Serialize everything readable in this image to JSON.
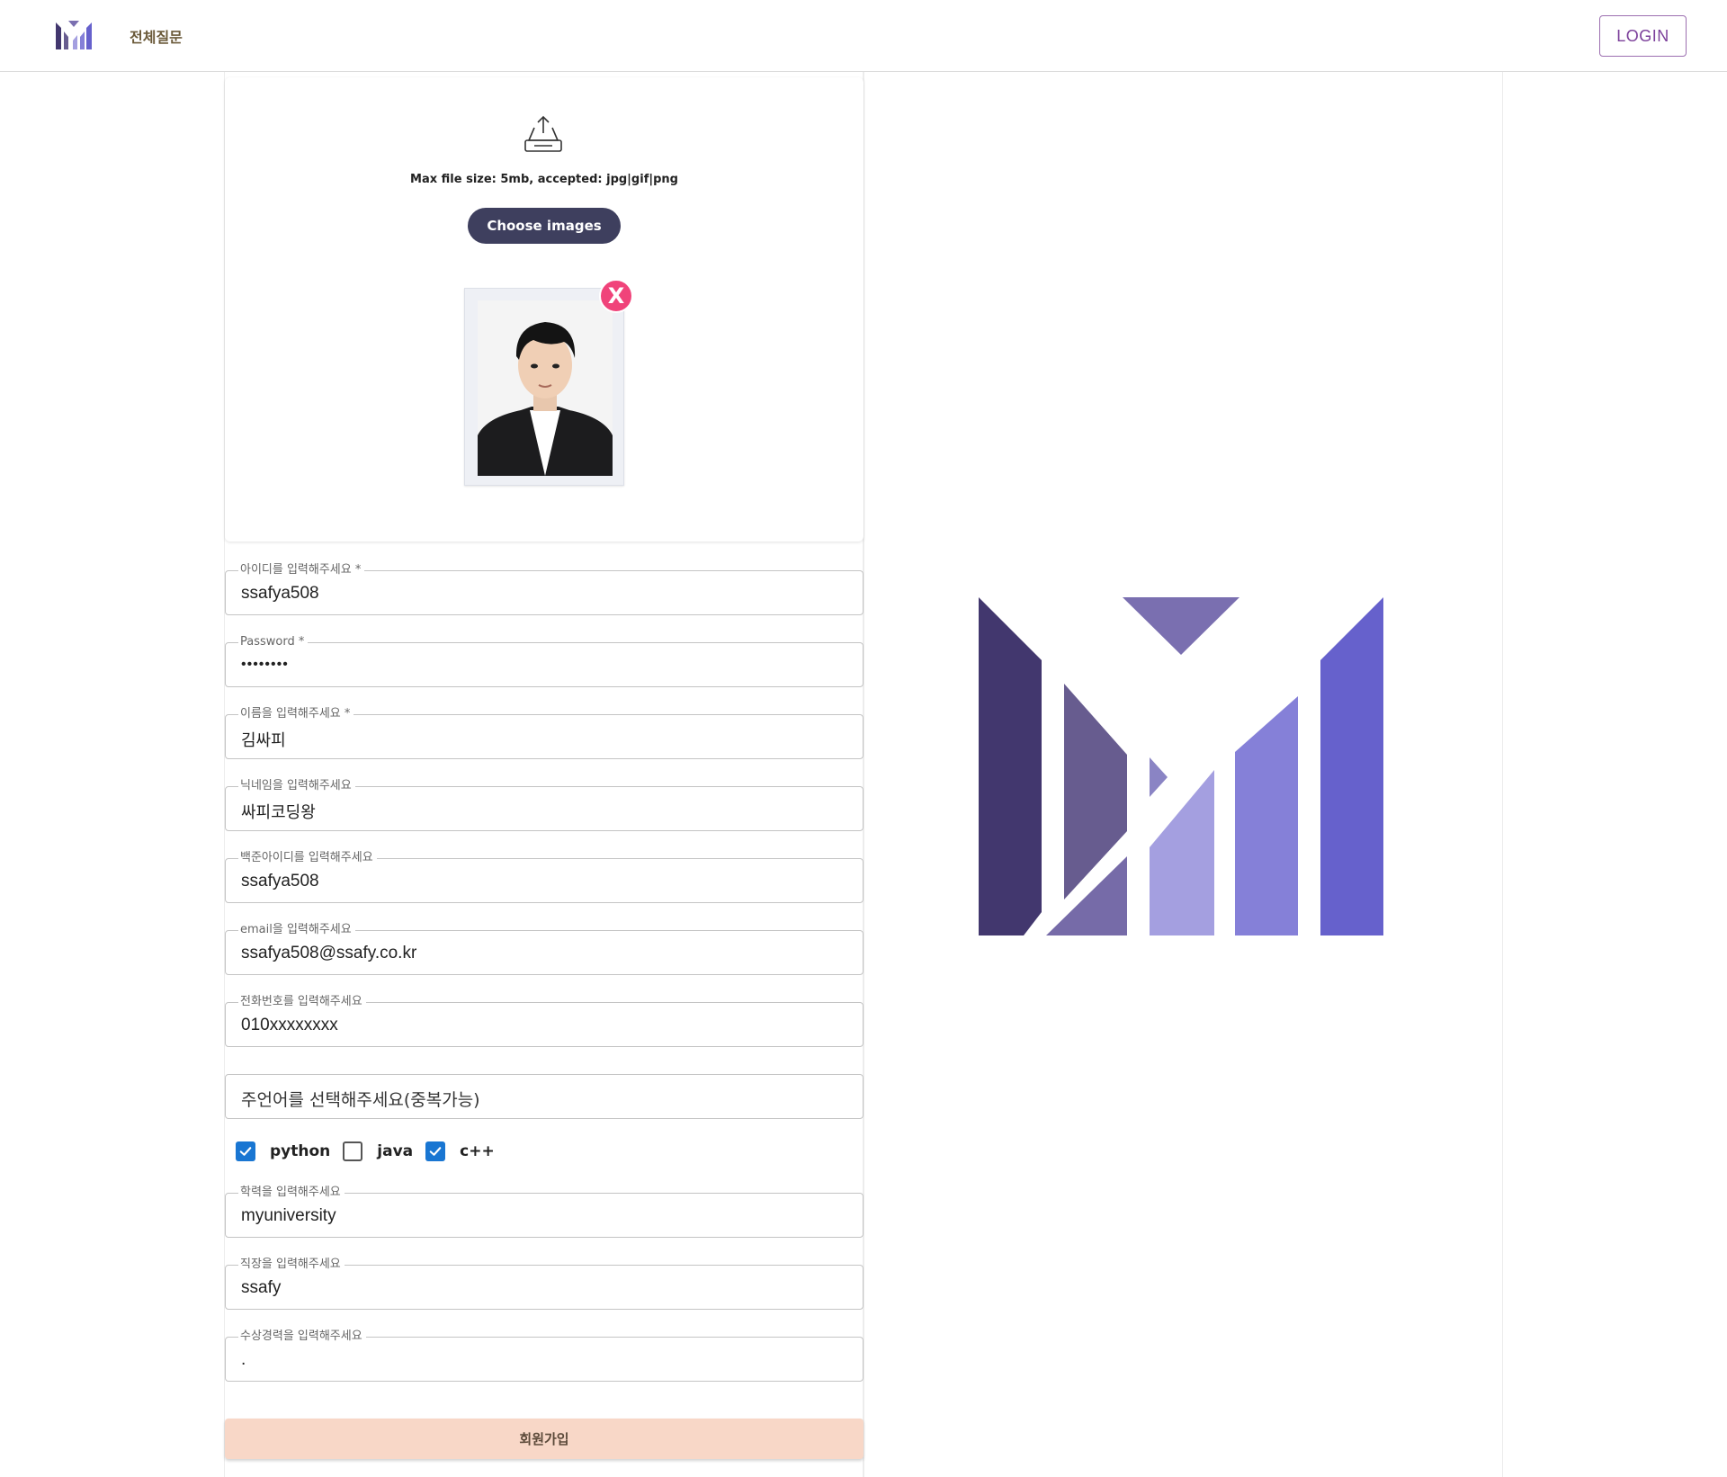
{
  "nav": {
    "link_all_questions": "전체질문",
    "login_label": "LOGIN"
  },
  "upload": {
    "hint": "Max file size: 5mb, accepted: jpg|gif|png",
    "choose_label": "Choose images",
    "remove_label": "X"
  },
  "fields": {
    "id": {
      "label": "아이디를 입력해주세요",
      "required": "*",
      "value": "ssafya508"
    },
    "password": {
      "label": "Password",
      "required": "*",
      "value": "••••••••"
    },
    "name": {
      "label": "이름을 입력해주세요",
      "required": "*",
      "value": "김싸피"
    },
    "nickname": {
      "label": "닉네임을 입력해주세요",
      "value": "싸피코딩왕"
    },
    "baekjoon": {
      "label": "백준아이디를 입력해주세요",
      "value": "ssafya508"
    },
    "email": {
      "label": "email을 입력해주세요",
      "value": "ssafya508@ssafy.co.kr"
    },
    "phone": {
      "label": "전화번호를 입력해주세요",
      "value": "010xxxxxxxx"
    },
    "education": {
      "label": "학력을 입력해주세요",
      "value": "myuniversity"
    },
    "job": {
      "label": "직장을 입력해주세요",
      "value": "ssafy"
    },
    "awards": {
      "label": "수상경력을 입력해주세요",
      "value": "."
    }
  },
  "language_select": {
    "placeholder": "주언어를 선택해주세요(중복가능)",
    "options": [
      {
        "label": "python",
        "checked": true
      },
      {
        "label": "java",
        "checked": false
      },
      {
        "label": "c++",
        "checked": true
      }
    ]
  },
  "submit_label": "회원가입",
  "colors": {
    "accent": "#1976d2",
    "login_border": "#9c6fb0",
    "choose_button": "#3e3f5e",
    "remove_button": "#f0437a",
    "submit_button": "#f8d7c7",
    "logo_dark": "#42376e",
    "logo_mid": "#675c8f",
    "logo_light": "#a49fe0",
    "logo_bright": "#6661cc"
  }
}
